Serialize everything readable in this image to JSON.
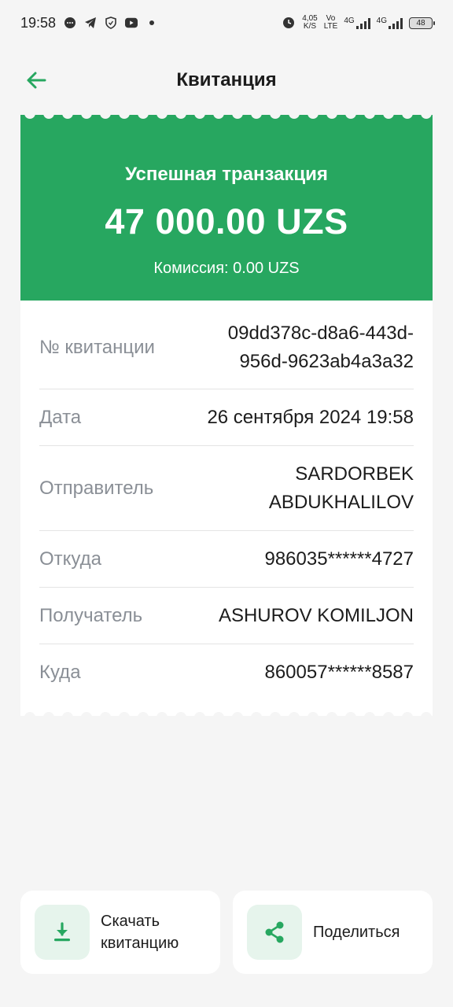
{
  "status_bar": {
    "time": "19:58",
    "net_speed_value": "4,05",
    "net_speed_unit": "K/S",
    "volte_top": "Vo",
    "volte_bottom": "LTE",
    "sig1_label": "4G",
    "sig2_label": "4G",
    "battery": "48"
  },
  "header": {
    "title": "Квитанция"
  },
  "receipt": {
    "status": "Успешная транзакция",
    "amount": "47 000.00 UZS",
    "commission": "Комиссия: 0.00 UZS",
    "rows": [
      {
        "label": "№ квитанции",
        "value_line1": "09dd378c-d8a6-443d-",
        "value_line2": "956d-9623ab4a3a32"
      },
      {
        "label": "Дата",
        "value_line1": "26 сентября 2024 19:58"
      },
      {
        "label": "Отправитель",
        "value_line1": "SARDORBEK",
        "value_line2": "ABDUKHALILOV"
      },
      {
        "label": "Откуда",
        "value_line1": "986035******4727"
      },
      {
        "label": "Получатель",
        "value_line1": "ASHUROV KOMILJON"
      },
      {
        "label": "Куда",
        "value_line1": "860057******8587"
      }
    ]
  },
  "actions": {
    "download_line1": "Скачать",
    "download_line2": "квитанцию",
    "share": "Поделиться"
  },
  "colors": {
    "accent": "#27a760",
    "icon_bg": "#e6f4ec",
    "background": "#f5f5f5"
  },
  "icons": {
    "back": "arrow-left-icon",
    "download": "download-icon",
    "share": "share-icon"
  }
}
